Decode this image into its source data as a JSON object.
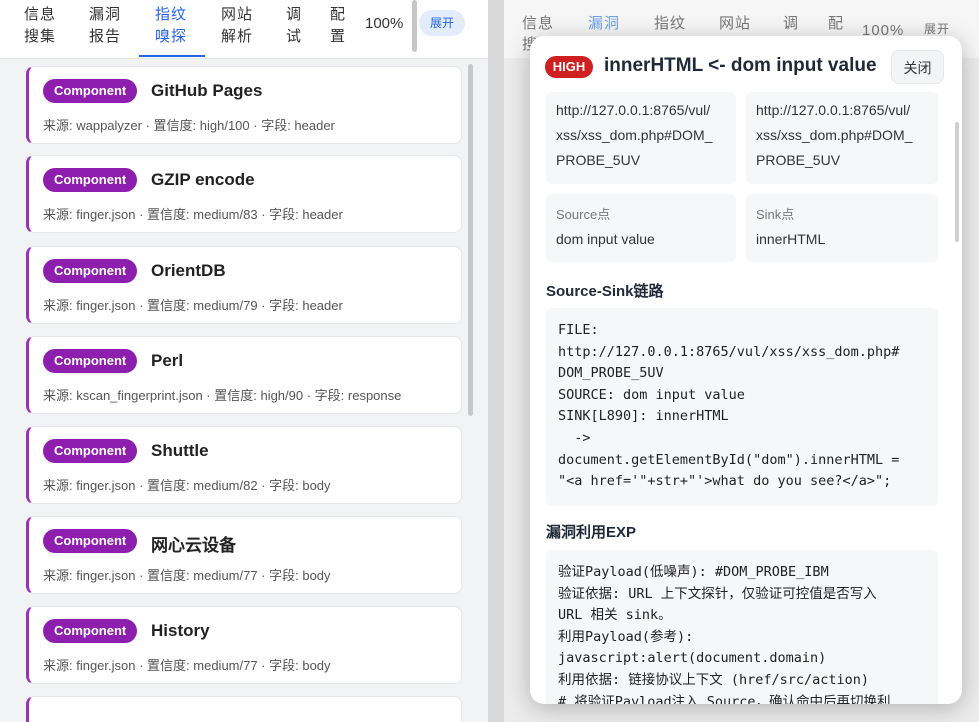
{
  "left": {
    "tabs": [
      {
        "l1": "信息",
        "l2": "搜集"
      },
      {
        "l1": "漏洞",
        "l2": "报告"
      },
      {
        "l1": "指纹",
        "l2": "嗅探"
      },
      {
        "l1": "网站",
        "l2": "解析"
      },
      {
        "l1": "调",
        "l2": "试"
      },
      {
        "l1": "配",
        "l2": "置"
      }
    ],
    "zoom": "100%",
    "expand_label": "展开",
    "cards": [
      {
        "badge": "Component",
        "title": "GitHub Pages",
        "meta": "来源: wappalyzer · 置信度: high/100 · 字段: header"
      },
      {
        "badge": "Component",
        "title": "GZIP encode",
        "meta": "来源: finger.json · 置信度: medium/83 · 字段: header"
      },
      {
        "badge": "Component",
        "title": "OrientDB",
        "meta": "来源: finger.json · 置信度: medium/79 · 字段: header"
      },
      {
        "badge": "Component",
        "title": "Perl",
        "meta": "来源: kscan_fingerprint.json · 置信度: high/90 · 字段: response"
      },
      {
        "badge": "Component",
        "title": "Shuttle",
        "meta": "来源: finger.json · 置信度: medium/82 · 字段: body"
      },
      {
        "badge": "Component",
        "title": "网心云设备",
        "meta": "来源: finger.json · 置信度: medium/77 · 字段: body"
      },
      {
        "badge": "Component",
        "title": "History",
        "meta": "来源: finger.json · 置信度: medium/77 · 字段: body"
      }
    ]
  },
  "right": {
    "tabs": [
      {
        "l1": "信息",
        "l2": "搜"
      },
      {
        "l1": "漏洞",
        "l2": ""
      },
      {
        "l1": "指纹",
        "l2": ""
      },
      {
        "l1": "网站",
        "l2": ""
      },
      {
        "l1": "调",
        "l2": ""
      },
      {
        "l1": "配",
        "l2": ""
      }
    ],
    "zoom": "100%",
    "expand_label": "展开"
  },
  "modal": {
    "severity": "HIGH",
    "title": "innerHTML <- dom input value",
    "close_label": "关闭",
    "url_left": [
      "http://127.0.0.1:8765/vul/",
      "xss/xss_dom.php#DOM_",
      "PROBE_5UV"
    ],
    "url_right": [
      "http://127.0.0.1:8765/vul/",
      "xss/xss_dom.php#DOM_",
      "PROBE_5UV"
    ],
    "source_label": "Source点",
    "source_value": "dom input value",
    "sink_label": "Sink点",
    "sink_value": "innerHTML",
    "chain_title": "Source-Sink链路",
    "chain_code": "FILE:\nhttp://127.0.0.1:8765/vul/xss/xss_dom.php#\nDOM_PROBE_5UV\nSOURCE: dom input value\nSINK[L890]: innerHTML\n  ->\ndocument.getElementById(\"dom\").innerHTML =\n\"<a href='\"+str+\"'>what do you see?</a>\";",
    "exp_title": "漏洞利用EXP",
    "exp_code": "验证Payload(低噪声): #DOM_PROBE_IBM\n验证依据: URL 上下文探针，仅验证可控值是否写入\nURL 相关 sink。\n利用Payload(参考):\njavascript:alert(document.domain)\n利用依据: 链接协议上下文 (href/src/action)\n# 将验证Payload注入 Source，确认命中后再切换利"
  }
}
